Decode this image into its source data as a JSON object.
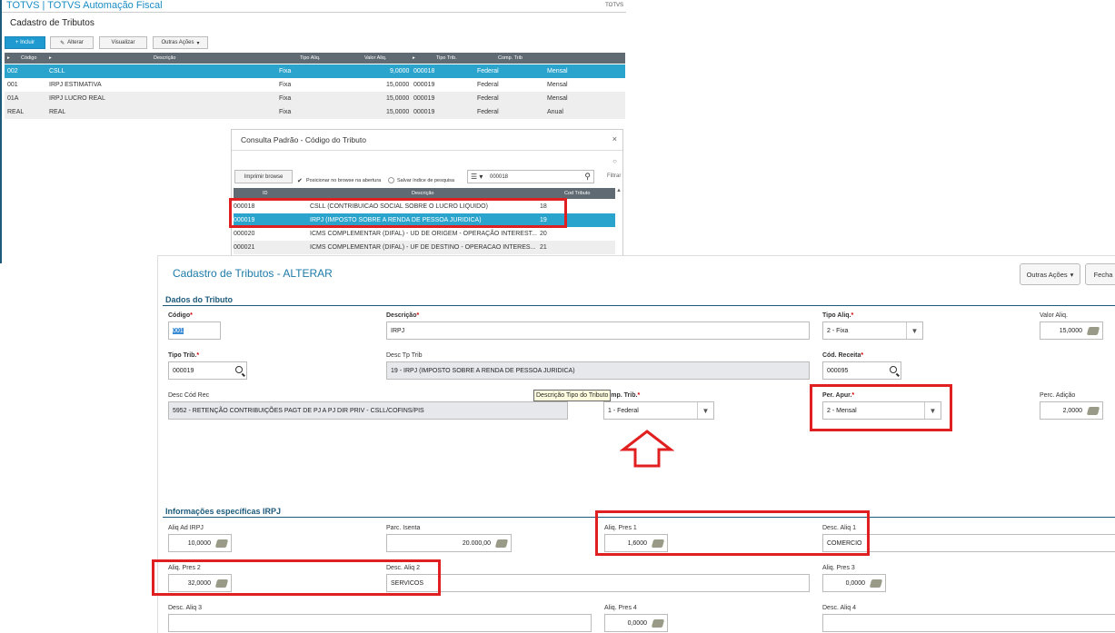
{
  "app": {
    "title": "TOTVS | TOTVS Automação Fiscal",
    "brand_right": "TOTVS",
    "screen_title": "Cadastro de Tributos"
  },
  "toolbar": {
    "incluir": "+ Incluir",
    "alterar": "Alterar",
    "visualizar": "Visualizar",
    "outras": "Outras Ações"
  },
  "grid": {
    "headers": [
      "Código",
      "Descrição",
      "Tipo Aliq.",
      "Valor Aliq.",
      "Tipo Trib.",
      "Comp. Trib"
    ],
    "rows": [
      {
        "codigo": "002",
        "descricao": "CSLL",
        "tipo": "Fixa",
        "valor": "9,0000",
        "trib": "000018",
        "comp": "Federal",
        "per": "Mensal"
      },
      {
        "codigo": "001",
        "descricao": "IRPJ ESTIMATIVA",
        "tipo": "Fixa",
        "valor": "15,0000",
        "trib": "000019",
        "comp": "Federal",
        "per": "Mensal"
      },
      {
        "codigo": "01A",
        "descricao": "IRPJ LUCRO REAL",
        "tipo": "Fixa",
        "valor": "15,0000",
        "trib": "000019",
        "comp": "Federal",
        "per": "Mensal"
      },
      {
        "codigo": "REAL",
        "descricao": "REAL",
        "tipo": "Fixa",
        "valor": "15,0000",
        "trib": "000019",
        "comp": "Federal",
        "per": "Anual"
      }
    ]
  },
  "lookup": {
    "title": "Consulta Padrão - Código do Tributo",
    "print_btn": "Imprimir browse",
    "chk1": "Posicionar no browse na abertura",
    "chk2": "Salvar índice de pesquisa",
    "search_value": "000018",
    "filter": "Filtrar",
    "headers": [
      "ID",
      "Descrição",
      "Cod Tributo"
    ],
    "rows": [
      {
        "id": "000018",
        "desc": "CSLL (CONTRIBUICAO SOCIAL SOBRE O LUCRO LIQUIDO)",
        "cod": "18"
      },
      {
        "id": "000019",
        "desc": "IRPJ (IMPOSTO SOBRE A RENDA DE PESSOA JURIDICA)",
        "cod": "19"
      },
      {
        "id": "000020",
        "desc": "ICMS COMPLEMENTAR (DIFAL) - UD DE ORIGEM - OPERAÇÃO INTEREST...",
        "cod": "20"
      },
      {
        "id": "000021",
        "desc": "ICMS COMPLEMENTAR (DIFAL) - UF DE DESTINO - OPERACAO INTERES...",
        "cod": "21"
      }
    ]
  },
  "form": {
    "title": "Cadastro de Tributos - ALTERAR",
    "outras": "Outras Ações",
    "fechar": "Fecha",
    "section1": "Dados do Tributo",
    "section2": "Informações específicas IRPJ",
    "codigo_lbl": "Código",
    "codigo_val": "001",
    "descricao_lbl": "Descrição",
    "descricao_val": "IRPJ",
    "tipoaliq_lbl": "Tipo Aliq.",
    "tipoaliq_val": "2 - Fixa",
    "valoraliq_lbl": "Valor Aliq.",
    "valoraliq_val": "15,0000",
    "tipotrib_lbl": "Tipo Trib.",
    "tipotrib_val": "000019",
    "desctp_lbl": "Desc Tp Trib",
    "desctp_val": "19 - IRPJ (IMPOSTO SOBRE A RENDA DE PESSOA JURIDICA)",
    "codrec_lbl": "Cód. Receita",
    "codrec_val": "000095",
    "desccod_lbl": "Desc Cód Rec",
    "desccod_val": "5952 - RETENÇÃO CONTRIBUIÇÕES PAGT DE PJ A PJ DIR PRIV - CSLL/COFINS/PIS",
    "tooltip": "Descrição Tipo do Tributo",
    "comptrib_lbl": "omp. Trib.",
    "comptrib_val": "1 - Federal",
    "perapur_lbl": "Per. Apur.",
    "perapur_val": "2 - Mensal",
    "percad_lbl": "Perc. Adição",
    "percad_val": "2,0000",
    "aliqad_lbl": "Aliq Ad IRPJ",
    "aliqad_val": "10,0000",
    "parcisenta_lbl": "Parc. Isenta",
    "parcisenta_val": "20.000,00",
    "pres1_lbl": "Aliq. Pres 1",
    "pres1_val": "1,6000",
    "desc1_lbl": "Desc. Aliq 1",
    "desc1_val": "COMERCIO",
    "pres2_lbl": "Aliq. Pres 2",
    "pres2_val": "32,0000",
    "desc2_lbl": "Desc. Aliq 2",
    "desc2_val": "SERVICOS",
    "pres3_lbl": "Aliq. Pres 3",
    "pres3_val": "0,0000",
    "desc3_lbl": "Desc. Aliq 3",
    "desc3_val": "",
    "pres4_lbl": "Aliq. Pres 4",
    "pres4_val": "0,0000",
    "desc4_lbl": "Desc. Aliq 4",
    "desc4_val": ""
  },
  "colors": {
    "accent": "#1f9ad0",
    "selected_row": "#2aa4cc",
    "highlight": "#e02020",
    "header": "#5f6a72"
  }
}
